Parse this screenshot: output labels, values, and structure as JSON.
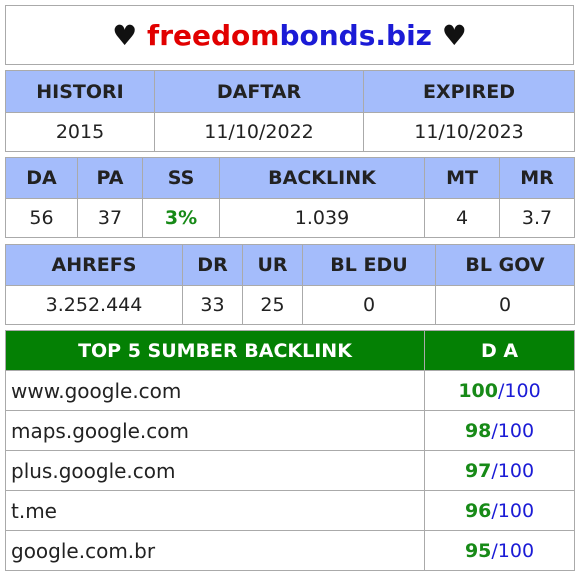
{
  "title": {
    "left_heart": "♥",
    "part_red": "freedom",
    "part_blue": "bonds.biz",
    "right_heart": "♥"
  },
  "dates": {
    "headers": [
      "HISTORI",
      "DAFTAR",
      "EXPIRED"
    ],
    "values": [
      "2015",
      "11/10/2022",
      "11/10/2023"
    ]
  },
  "metrics": {
    "headers": [
      "DA",
      "PA",
      "SS",
      "BACKLINK",
      "MT",
      "MR"
    ],
    "values": [
      "56",
      "37",
      "3%",
      "1.039",
      "4",
      "3.7"
    ]
  },
  "ahrefs": {
    "headers": [
      "AHREFS",
      "DR",
      "UR",
      "BL EDU",
      "BL GOV"
    ],
    "values": [
      "3.252.444",
      "33",
      "25",
      "0",
      "0"
    ]
  },
  "top_backlinks": {
    "header_source": "TOP 5 SUMBER BACKLINK",
    "header_da": "D A",
    "rows": [
      {
        "site": "www.google.com",
        "da": "100",
        "max": "/100"
      },
      {
        "site": "maps.google.com",
        "da": "98",
        "max": "/100"
      },
      {
        "site": "plus.google.com",
        "da": "97",
        "max": "/100"
      },
      {
        "site": "t.me",
        "da": "96",
        "max": "/100"
      },
      {
        "site": "google.com.br",
        "da": "95",
        "max": "/100"
      }
    ]
  },
  "colors": {
    "header_bg": "#a4bcfb",
    "top_header_bg": "#048004",
    "brand_red": "#e10000",
    "brand_blue": "#1b1bd6",
    "good_green": "#178a17"
  }
}
